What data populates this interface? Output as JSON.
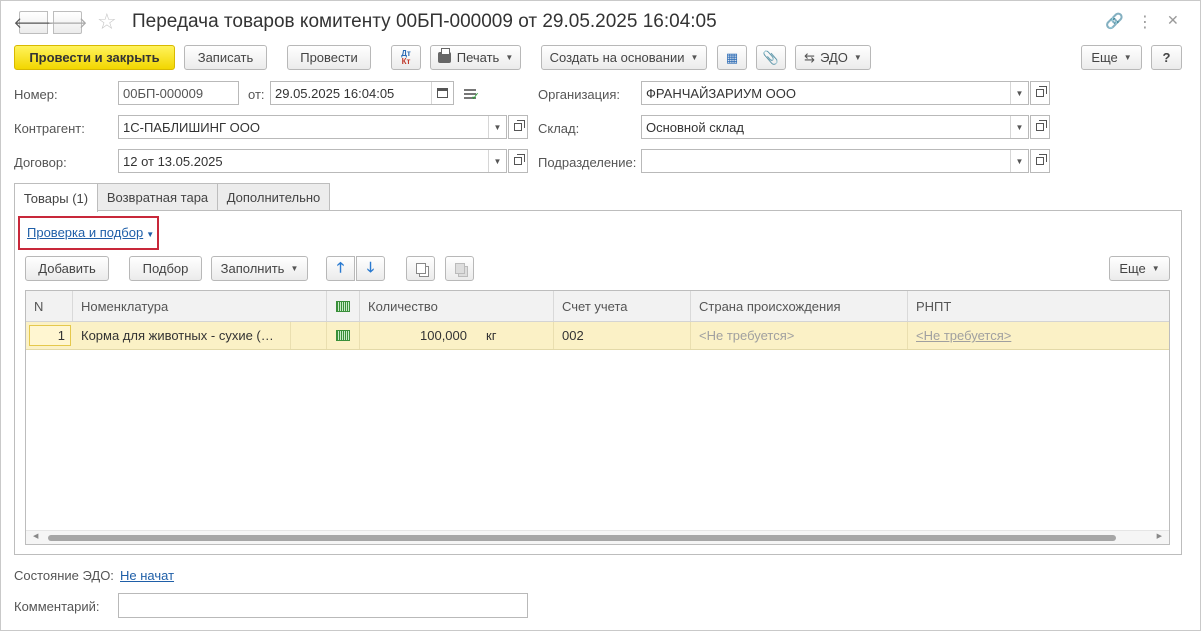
{
  "window": {
    "title": "Передача товаров комитенту 00БП-000009 от 29.05.2025 16:04:05"
  },
  "toolbar": {
    "post_close": "Провести и закрыть",
    "save": "Записать",
    "post": "Провести",
    "dt_kt_top": "Дт",
    "dt_kt_bottom": "Кт",
    "print": "Печать",
    "create_based": "Создать на основании",
    "edo": "ЭДО",
    "more": "Еще",
    "help": "?"
  },
  "form": {
    "number_label": "Номер:",
    "number_value": "00БП-000009",
    "from_label": "от:",
    "date_value": "29.05.2025 16:04:05",
    "org_label": "Организация:",
    "org_value": "ФРАНЧАЙЗАРИУМ ООО",
    "contractor_label": "Контрагент:",
    "contractor_value": "1С-ПАБЛИШИНГ ООО",
    "warehouse_label": "Склад:",
    "warehouse_value": "Основной склад",
    "contract_label": "Договор:",
    "contract_value": "12 от 13.05.2025",
    "division_label": "Подразделение:",
    "division_value": ""
  },
  "tabs": [
    {
      "label": "Товары (1)",
      "active": true
    },
    {
      "label": "Возвратная тара",
      "active": false
    },
    {
      "label": "Дополнительно",
      "active": false
    }
  ],
  "goods": {
    "check_link": "Проверка и подбор",
    "add": "Добавить",
    "select": "Подбор",
    "fill": "Заполнить",
    "more": "Еще",
    "columns": {
      "n": "N",
      "nomenclature": "Номенклатура",
      "quantity": "Количество",
      "account": "Счет учета",
      "country": "Страна происхождения",
      "rnpt": "РНПТ"
    },
    "rows": [
      {
        "n": "1",
        "nomenclature": "Корма для животных - сухие (…",
        "quantity": "100,000",
        "unit": "кг",
        "account": "002",
        "country": "<Не требуется>",
        "rnpt": "<Не требуется>"
      }
    ]
  },
  "footer": {
    "edo_state_label": "Состояние ЭДО:",
    "edo_state_value": "Не начат",
    "comment_label": "Комментарий:",
    "comment_value": ""
  },
  "colors": {
    "primary_button": "#f2d600",
    "row_highlight": "#fbf1c6",
    "link": "#1f5fa8",
    "highlight_box": "#c8283a"
  }
}
